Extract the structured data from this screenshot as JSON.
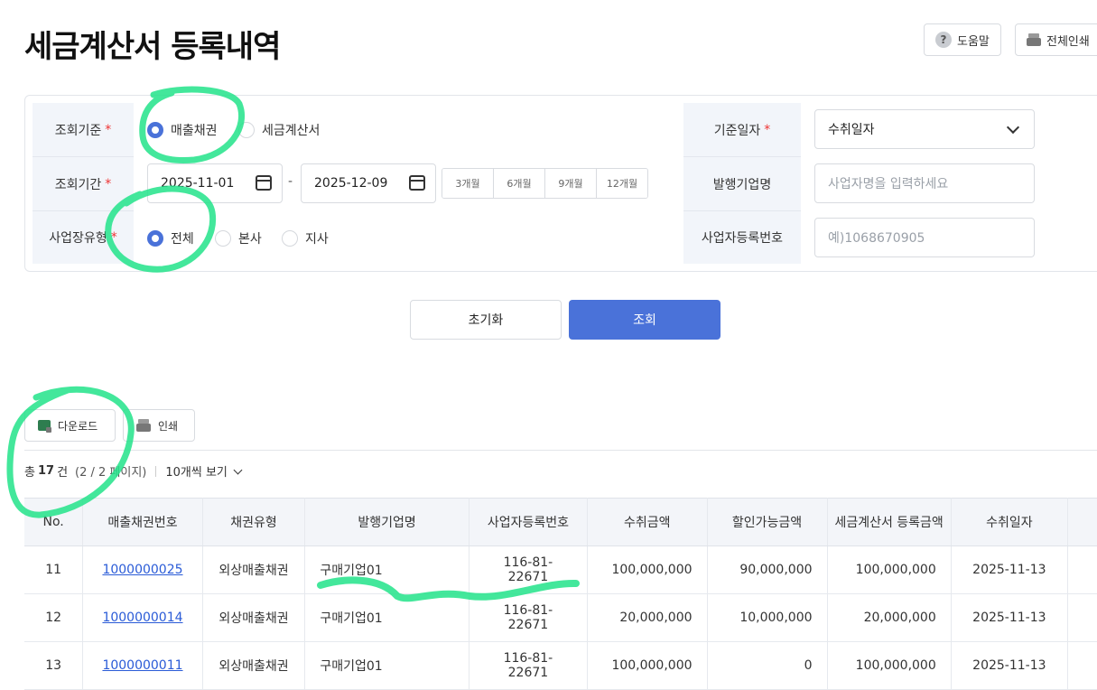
{
  "page_title": "세금계산서 등록내역",
  "top_buttons": {
    "help": "도움말",
    "print_all": "전체인쇄"
  },
  "filter": {
    "criteria": {
      "label": "조회기준",
      "required": "*",
      "options": [
        "매출채권",
        "세금계산서"
      ],
      "selected": "매출채권"
    },
    "period": {
      "label": "조회기간",
      "required": "*",
      "start": "2025-11-01",
      "end": "2025-12-09",
      "separator": "-",
      "quick": [
        "3개월",
        "6개월",
        "9개월",
        "12개월"
      ]
    },
    "site_type": {
      "label": "사업장유형",
      "required": "*",
      "options": [
        "전체",
        "본사",
        "지사"
      ],
      "selected": "전체"
    },
    "base_date": {
      "label": "기준일자",
      "required": "*",
      "value": "수취일자"
    },
    "issuer": {
      "label": "발행기업명",
      "placeholder": "사업자명을 입력하세요"
    },
    "biz_no": {
      "label": "사업자등록번호",
      "placeholder": "예)1068670905"
    }
  },
  "actions": {
    "reset": "초기화",
    "search": "조회"
  },
  "list_toolbar": {
    "download": "다운로드",
    "print": "인쇄"
  },
  "summary": {
    "prefix": "총",
    "count": "17",
    "suffix": "건",
    "pages": "(2 / 2 페이지)",
    "page_size": "10개씩 보기"
  },
  "table": {
    "headers": [
      "No.",
      "매출채권번호",
      "채권유형",
      "발행기업명",
      "사업자등록번호",
      "수취금액",
      "할인가능금액",
      "세금계산서 등록금액",
      "수취일자"
    ],
    "rows": [
      [
        "11",
        "1000000025",
        "외상매출채권",
        "구매기업01",
        "116-81-22671",
        "100,000,000",
        "90,000,000",
        "100,000,000",
        "2025-11-13"
      ],
      [
        "12",
        "1000000014",
        "외상매출채권",
        "구매기업01",
        "116-81-22671",
        "20,000,000",
        "10,000,000",
        "20,000,000",
        "2025-11-13"
      ],
      [
        "13",
        "1000000011",
        "외상매출채권",
        "구매기업01",
        "116-81-22671",
        "100,000,000",
        "0",
        "100,000,000",
        "2025-11-13"
      ]
    ]
  },
  "colors": {
    "accent": "#4a72d9",
    "highlighter": "#22e38a",
    "required": "#e33333"
  }
}
